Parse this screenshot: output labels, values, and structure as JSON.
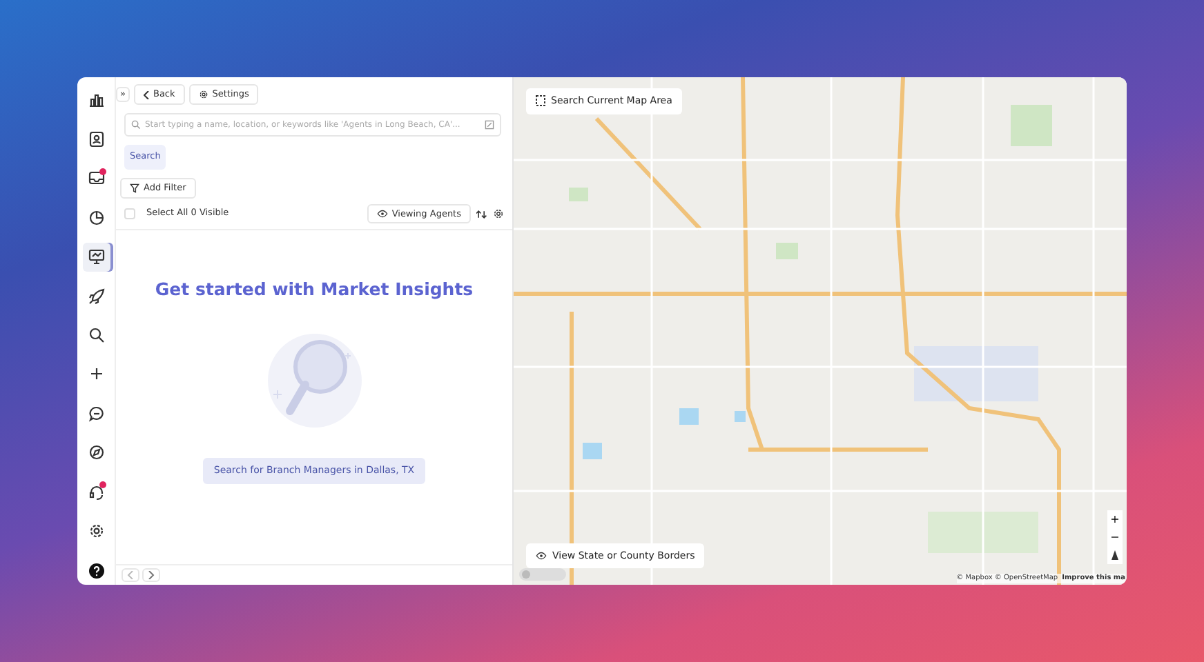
{
  "sidebar": {
    "items": [
      {
        "kind": "chart",
        "selected": false,
        "badge": false
      },
      {
        "kind": "contact",
        "selected": false,
        "badge": false
      },
      {
        "kind": "inbox",
        "selected": false,
        "badge": true
      },
      {
        "kind": "pie",
        "selected": false,
        "badge": false
      },
      {
        "kind": "monitor",
        "selected": true,
        "badge": false
      },
      {
        "kind": "rocket",
        "selected": false,
        "badge": false
      },
      {
        "kind": "search",
        "selected": false,
        "badge": false
      },
      {
        "kind": "plus",
        "selected": false,
        "badge": false
      },
      {
        "kind": "chat",
        "selected": false,
        "badge": false
      },
      {
        "kind": "compass",
        "selected": false,
        "badge": false
      },
      {
        "kind": "headset",
        "selected": false,
        "badge": true
      },
      {
        "kind": "gear",
        "selected": false,
        "badge": false
      },
      {
        "kind": "help",
        "selected": false,
        "badge": false
      }
    ]
  },
  "toolbar": {
    "expand": "»",
    "back": "Back",
    "settings": "Settings"
  },
  "search": {
    "placeholder": "Start typing a name, location, or keywords like 'Agents in Long Beach, CA'...",
    "button": "Search"
  },
  "add_filter": "Add Filter",
  "list_header": {
    "select_all": {
      "label": "Select All 0 Visible",
      "checked": false
    },
    "viewing": "Viewing Agents"
  },
  "empty_state": {
    "title": "Get started with Market Insights",
    "button": "Search for Branch Managers in Dallas, TX"
  },
  "map": {
    "search_area": "Search Current Map Area",
    "borders": "View State or County Borders",
    "zoom_in": "+",
    "zoom_out": "−",
    "attribution": "© Mapbox © OpenStreetMap",
    "improve": "Improve this ma"
  }
}
